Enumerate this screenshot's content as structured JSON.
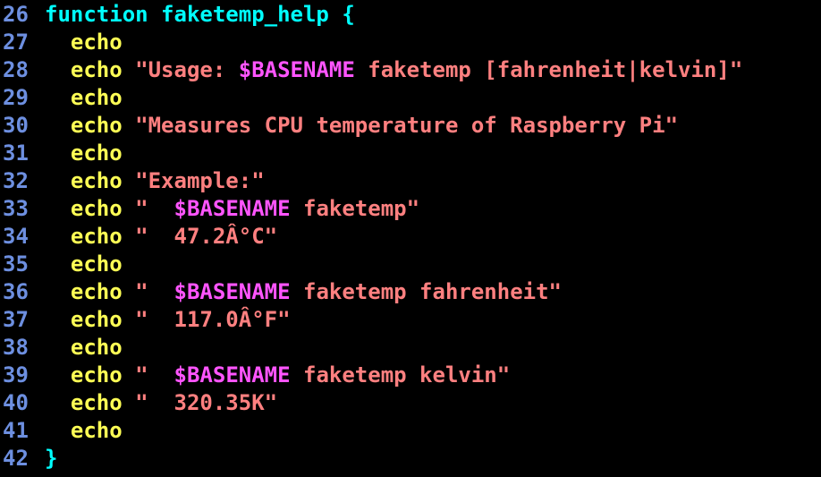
{
  "colors": {
    "background": "#000000",
    "line_number": "#6d8fe0",
    "keyword": "#00ffff",
    "command": "#ffff55",
    "string": "#ff8080",
    "variable": "#ff55ff"
  },
  "lines": [
    {
      "n": "26",
      "tokens": [
        {
          "t": "kw",
          "v": "function faketemp_help "
        },
        {
          "t": "brace",
          "v": "{"
        }
      ]
    },
    {
      "n": "27",
      "tokens": [
        {
          "t": "sp",
          "v": "  "
        },
        {
          "t": "cmd",
          "v": "echo"
        }
      ]
    },
    {
      "n": "28",
      "tokens": [
        {
          "t": "sp",
          "v": "  "
        },
        {
          "t": "cmd",
          "v": "echo"
        },
        {
          "t": "sp",
          "v": " "
        },
        {
          "t": "str",
          "v": "\"Usage: "
        },
        {
          "t": "var",
          "v": "$BASENAME"
        },
        {
          "t": "str",
          "v": " faketemp [fahrenheit|kelvin]\""
        }
      ]
    },
    {
      "n": "29",
      "tokens": [
        {
          "t": "sp",
          "v": "  "
        },
        {
          "t": "cmd",
          "v": "echo"
        }
      ]
    },
    {
      "n": "30",
      "tokens": [
        {
          "t": "sp",
          "v": "  "
        },
        {
          "t": "cmd",
          "v": "echo"
        },
        {
          "t": "sp",
          "v": " "
        },
        {
          "t": "str",
          "v": "\"Measures CPU temperature of Raspberry Pi\""
        }
      ]
    },
    {
      "n": "31",
      "tokens": [
        {
          "t": "sp",
          "v": "  "
        },
        {
          "t": "cmd",
          "v": "echo"
        }
      ]
    },
    {
      "n": "32",
      "tokens": [
        {
          "t": "sp",
          "v": "  "
        },
        {
          "t": "cmd",
          "v": "echo"
        },
        {
          "t": "sp",
          "v": " "
        },
        {
          "t": "str",
          "v": "\"Example:\""
        }
      ]
    },
    {
      "n": "33",
      "tokens": [
        {
          "t": "sp",
          "v": "  "
        },
        {
          "t": "cmd",
          "v": "echo"
        },
        {
          "t": "sp",
          "v": " "
        },
        {
          "t": "str",
          "v": "\"  "
        },
        {
          "t": "var",
          "v": "$BASENAME"
        },
        {
          "t": "str",
          "v": " faketemp\""
        }
      ]
    },
    {
      "n": "34",
      "tokens": [
        {
          "t": "sp",
          "v": "  "
        },
        {
          "t": "cmd",
          "v": "echo"
        },
        {
          "t": "sp",
          "v": " "
        },
        {
          "t": "str",
          "v": "\"  47.2Â°C\""
        }
      ]
    },
    {
      "n": "35",
      "tokens": [
        {
          "t": "sp",
          "v": "  "
        },
        {
          "t": "cmd",
          "v": "echo"
        }
      ]
    },
    {
      "n": "36",
      "tokens": [
        {
          "t": "sp",
          "v": "  "
        },
        {
          "t": "cmd",
          "v": "echo"
        },
        {
          "t": "sp",
          "v": " "
        },
        {
          "t": "str",
          "v": "\"  "
        },
        {
          "t": "var",
          "v": "$BASENAME"
        },
        {
          "t": "str",
          "v": " faketemp fahrenheit\""
        }
      ]
    },
    {
      "n": "37",
      "tokens": [
        {
          "t": "sp",
          "v": "  "
        },
        {
          "t": "cmd",
          "v": "echo"
        },
        {
          "t": "sp",
          "v": " "
        },
        {
          "t": "str",
          "v": "\"  117.0Â°F\""
        }
      ]
    },
    {
      "n": "38",
      "tokens": [
        {
          "t": "sp",
          "v": "  "
        },
        {
          "t": "cmd",
          "v": "echo"
        }
      ]
    },
    {
      "n": "39",
      "tokens": [
        {
          "t": "sp",
          "v": "  "
        },
        {
          "t": "cmd",
          "v": "echo"
        },
        {
          "t": "sp",
          "v": " "
        },
        {
          "t": "str",
          "v": "\"  "
        },
        {
          "t": "var",
          "v": "$BASENAME"
        },
        {
          "t": "str",
          "v": " faketemp kelvin\""
        }
      ]
    },
    {
      "n": "40",
      "tokens": [
        {
          "t": "sp",
          "v": "  "
        },
        {
          "t": "cmd",
          "v": "echo"
        },
        {
          "t": "sp",
          "v": " "
        },
        {
          "t": "str",
          "v": "\"  320.35K\""
        }
      ]
    },
    {
      "n": "41",
      "tokens": [
        {
          "t": "sp",
          "v": "  "
        },
        {
          "t": "cmd",
          "v": "echo"
        }
      ]
    },
    {
      "n": "42",
      "tokens": [
        {
          "t": "brace",
          "v": "}"
        }
      ]
    }
  ]
}
